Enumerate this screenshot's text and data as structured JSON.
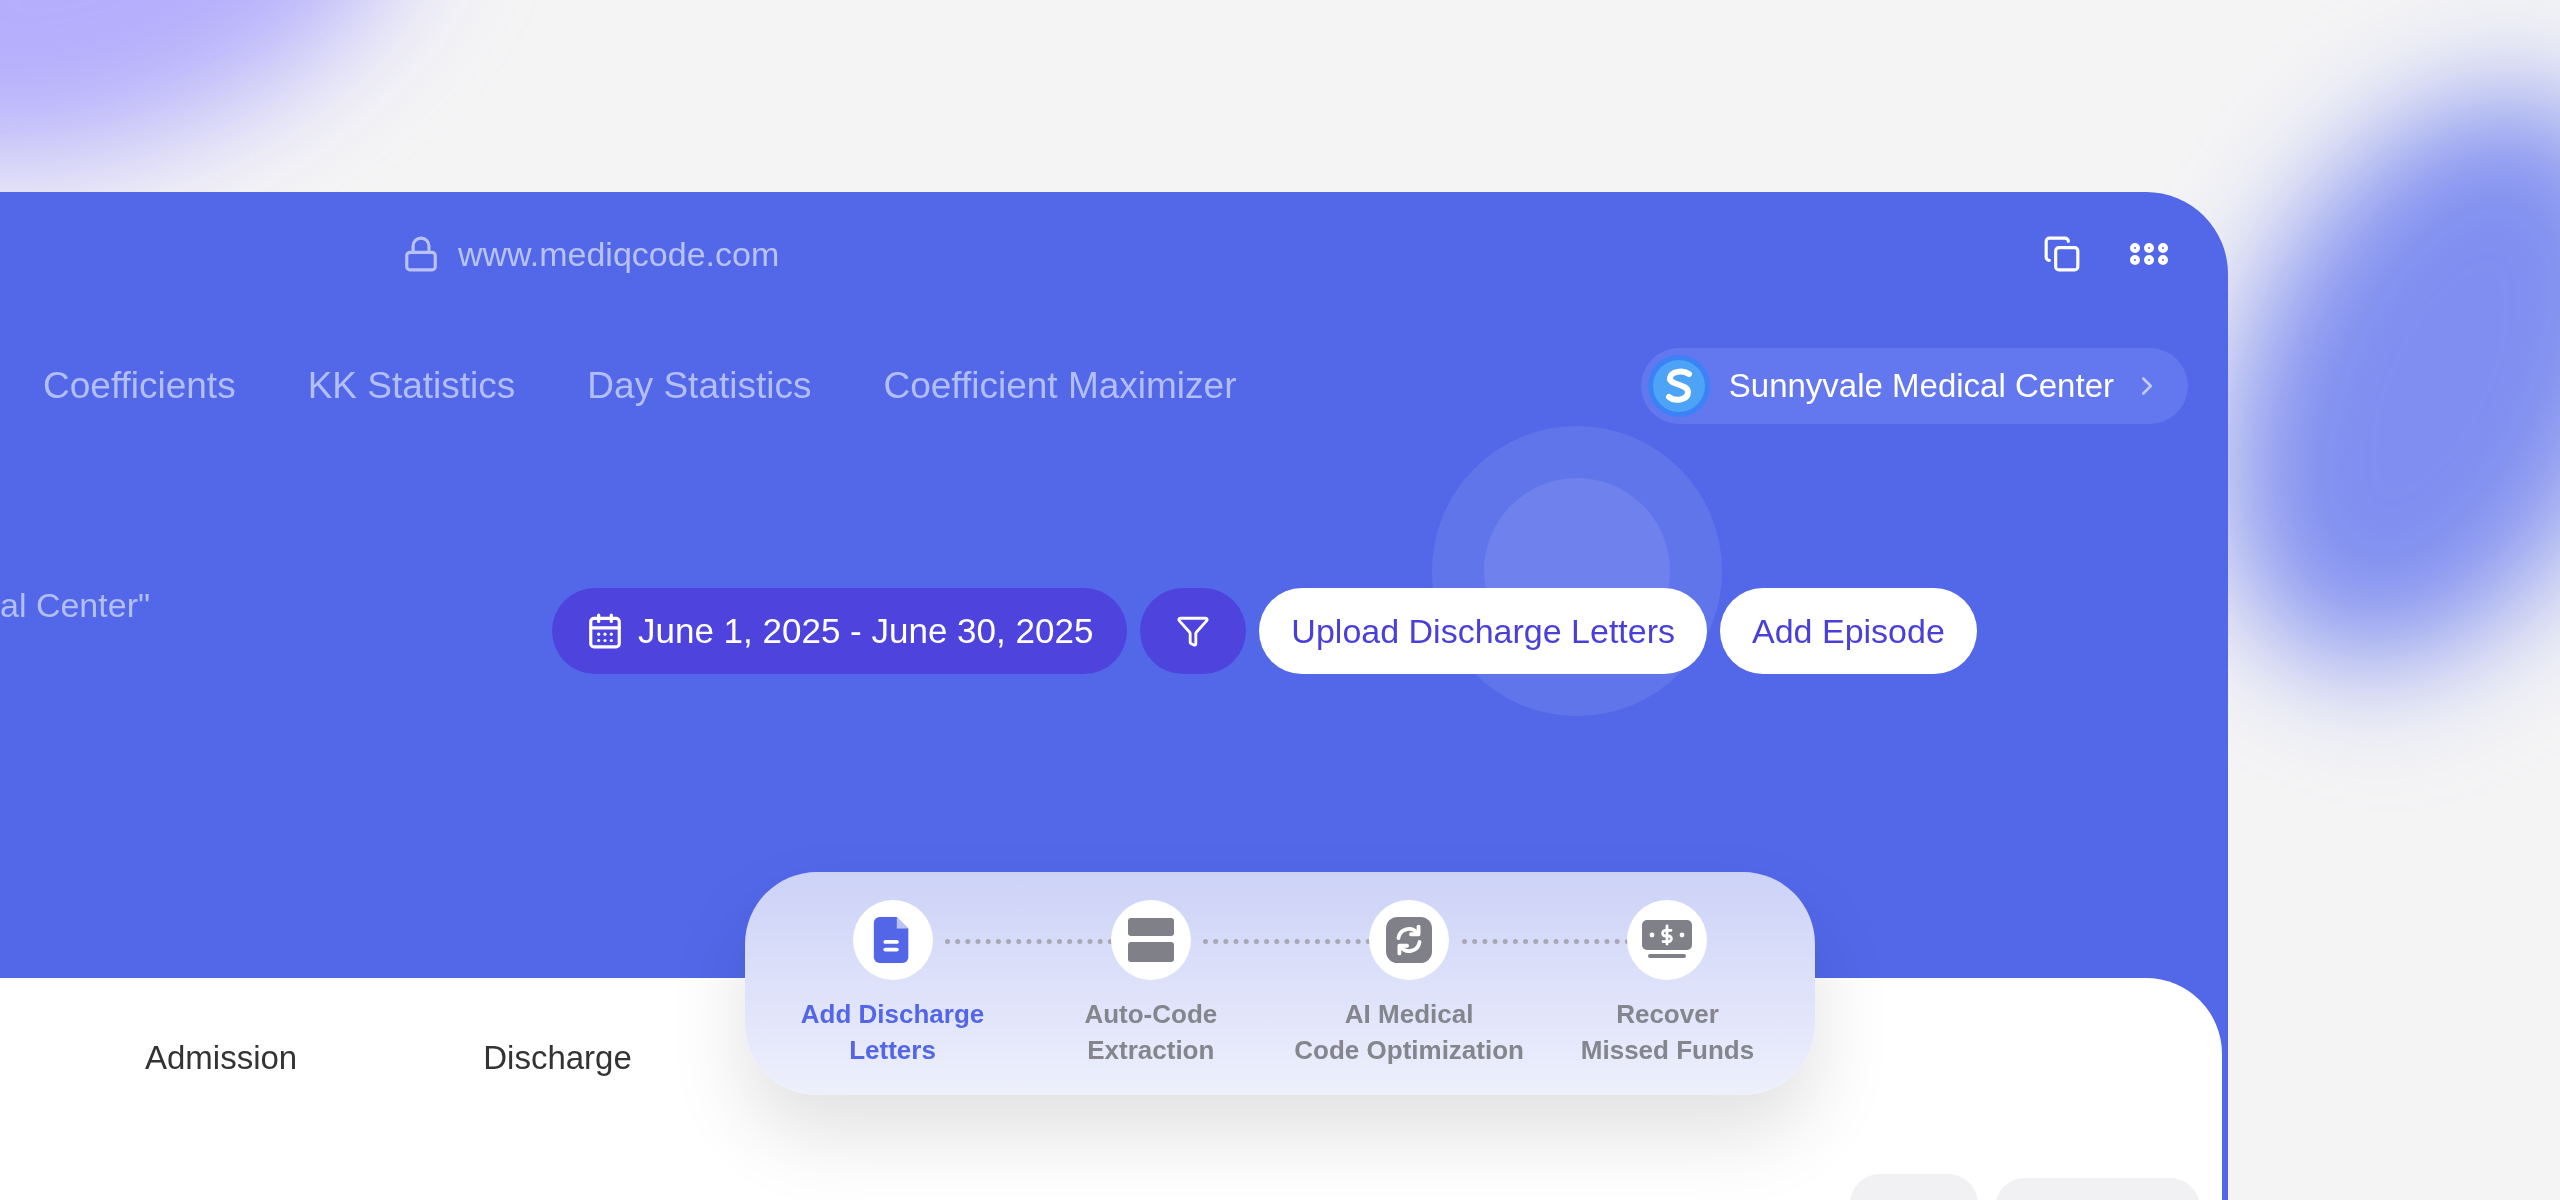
{
  "browser": {
    "url": "www.mediqcode.com"
  },
  "nav": {
    "items": [
      {
        "label": "Coefficients",
        "selected": false
      },
      {
        "label": "KK Statistics",
        "selected": false
      },
      {
        "label": "Day Statistics",
        "selected": false
      },
      {
        "label": "Coefficient Maximizer",
        "selected": false
      }
    ],
    "clinic": {
      "name": "Sunnyvale Medical Center"
    }
  },
  "header": {
    "subtitle": "al Center\"",
    "date_range": "June 1, 2025 - June 30, 2025",
    "actions": [
      "Upload Discharge Letters",
      "Add Episode"
    ]
  },
  "steps": [
    {
      "label": "Add Discharge\nLetters",
      "selected": true,
      "kind": "document"
    },
    {
      "label": "Auto-Code\nExtraction",
      "selected": false,
      "kind": "extract"
    },
    {
      "label": "AI Medical\nCode Optimization",
      "selected": false,
      "kind": "optimize"
    },
    {
      "label": "Recover\nMissed Funds",
      "selected": false,
      "kind": "funds"
    }
  ],
  "table": {
    "columns": [
      "Admission",
      "Discharge"
    ]
  }
}
